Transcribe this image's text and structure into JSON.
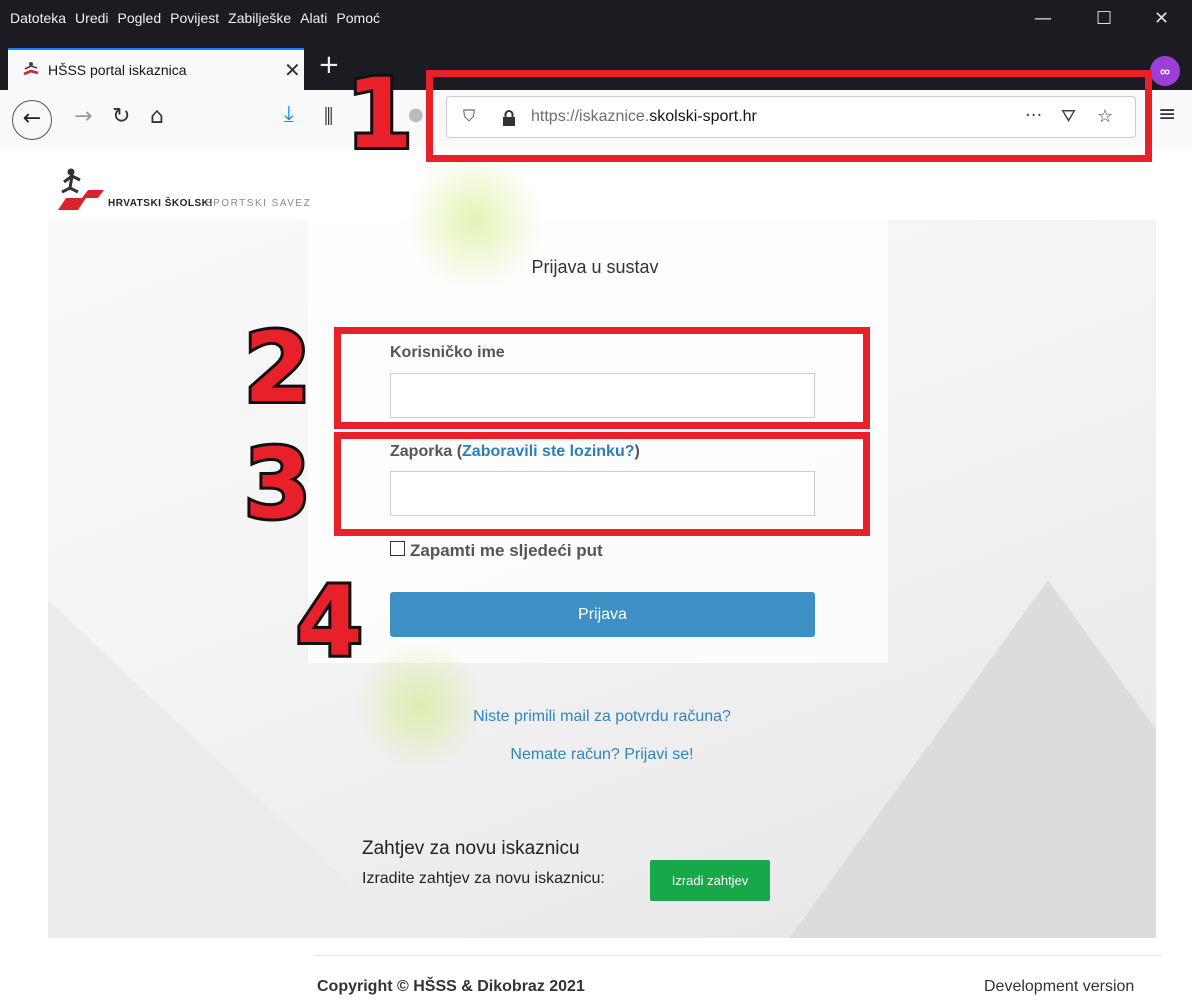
{
  "browser": {
    "menu": [
      "Datoteka",
      "Uredi",
      "Pogled",
      "Povijest",
      "Zabilješke",
      "Alati",
      "Pomoć"
    ],
    "tab_title": "HŠSS portal iskaznica",
    "url_prefix": "https://iskaznice.",
    "url_domain": "skolski-sport.hr",
    "icons": {
      "back": "back-arrow-icon",
      "forward": "forward-arrow-icon",
      "reload": "reload-icon",
      "home": "home-icon",
      "download": "download-icon",
      "library": "library-icon",
      "shield": "tracking-shield-icon",
      "lock": "lock-icon",
      "more": "more-icon",
      "pocket": "pocket-icon",
      "star": "bookmark-star-icon",
      "hamburger": "hamburger-menu-icon"
    }
  },
  "annotations": [
    "1",
    "2",
    "3",
    "4"
  ],
  "logo": {
    "text_bold": "HRVATSKI ŠKOLSKI",
    "text_light": "SPORTSKI SAVEZ"
  },
  "login": {
    "title": "Prijava u sustav",
    "username_label": "Korisničko ime",
    "password_label_prefix": "Zaporka (",
    "forgot_link": "Zaboravili ste lozinku?",
    "password_label_suffix": ")",
    "remember_label": "Zapamti me sljedeći put",
    "submit_label": "Prijava",
    "no_mail_link": "Niste primili mail za potvrdu računa?",
    "register_link": "Nemate račun? Prijavi se!"
  },
  "request": {
    "title": "Zahtjev za novu iskaznicu",
    "text": "Izradite zahtjev za novu iskaznicu:",
    "button": "Izradi zahtjev"
  },
  "footer": {
    "copyright": "Copyright © HŠSS & Dikobraz 2021",
    "version": "Development version"
  },
  "colors": {
    "annotation_red": "#e8202a",
    "primary_button": "#3d8fc4",
    "success_button": "#17a84a",
    "link": "#2e86c1"
  }
}
